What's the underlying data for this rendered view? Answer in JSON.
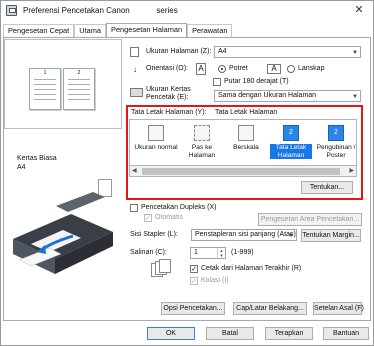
{
  "window": {
    "title": "Preferensi Pencetakan Canon            series",
    "close_glyph": "✕"
  },
  "tabs": [
    {
      "label": "Pengesetan Cepat"
    },
    {
      "label": "Utama"
    },
    {
      "label": "Pengesetan Halaman"
    },
    {
      "label": "Perawatan"
    }
  ],
  "preview": {
    "page_left_num": "1",
    "page_right_num": "2",
    "paper_type_label": "Kertas Biasa",
    "paper_size_label": "A4"
  },
  "page_setup": {
    "page_size_label": "Ukuran Halaman (Z):",
    "page_size_value": "A4",
    "orientation_label": "Orientasi (O):",
    "portrait_label": "Potret",
    "landscape_label": "Lanskap",
    "rotate180_label": "Putar 180 derajat (T)",
    "printer_paper_size_label_1": "Ukuran Kertas",
    "printer_paper_size_label_2": "Pencetak (E):",
    "printer_paper_size_value": "Sama dengan Ukuran Halaman",
    "layout_label": "Tata Letak Halaman (Y):",
    "layout_value": "Tata Letak Halaman",
    "layout_items": [
      {
        "label": "Ukuran normal",
        "glyph": ""
      },
      {
        "label": "Pas ke Halaman",
        "glyph": ""
      },
      {
        "label": "Berskala",
        "glyph": ""
      },
      {
        "label": "Tata Letak Halaman",
        "glyph": "2"
      },
      {
        "label": "Pengubinan / Poster",
        "glyph": "2"
      }
    ],
    "specify_button": "Tentukan...",
    "duplex_label": "Pencetakan Dupleks (X)",
    "auto_label": "Otomatis",
    "duplex_area_button": "Pengesetan Area Pencetakan...",
    "stapling_label": "Sisi Stapler (L):",
    "stapling_value": "Penstapleran sisi panjang (Atas)",
    "margin_button": "Tentukan Margin...",
    "copies_label": "Salinan (C):",
    "copies_value": "1",
    "copies_range": "(1-999)",
    "print_last_first_label": "Cetak dari Halaman Terakhir (R)",
    "collate_label": "Kolasi (I)"
  },
  "bottom_buttons": {
    "print_options": "Opsi Pencetakan...",
    "stamp_background": "Cap/Latar Belakang...",
    "defaults": "Setelan Asal (F)"
  },
  "dialog_buttons": {
    "ok": "OK",
    "cancel": "Batal",
    "apply": "Terapkan",
    "help": "Bantuan"
  },
  "colors": {
    "highlight_border": "#e01818",
    "selection_blue": "#1877e8"
  }
}
